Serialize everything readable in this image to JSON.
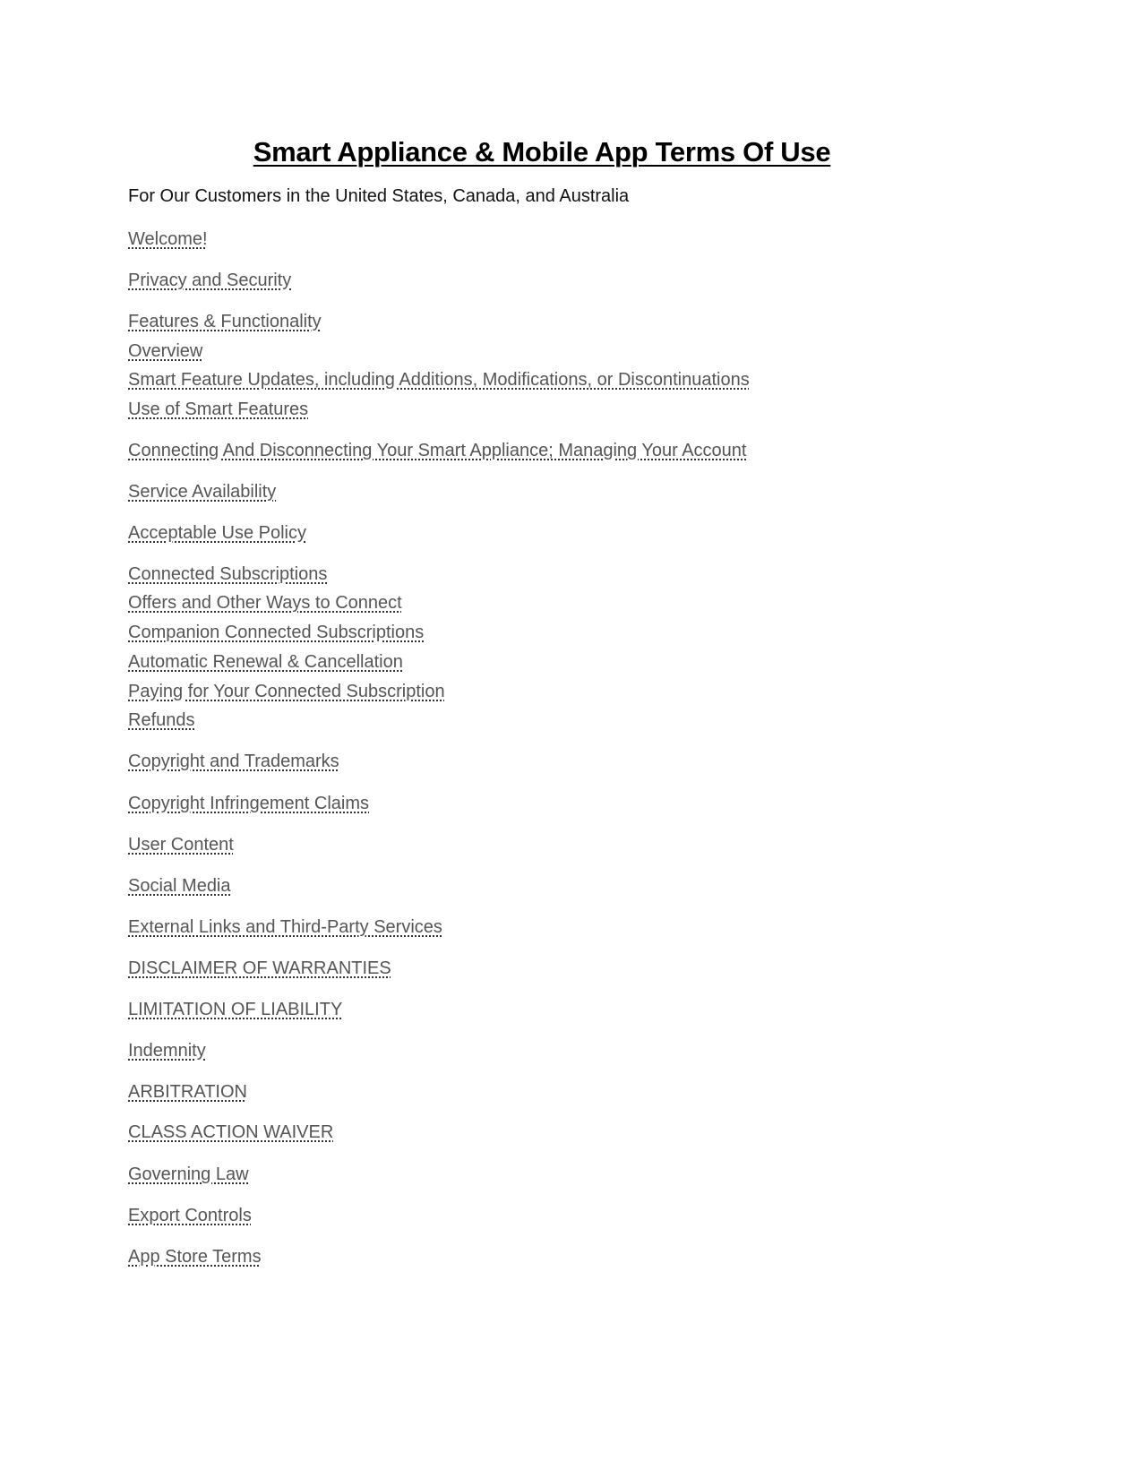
{
  "document": {
    "title": "Smart Appliance & Mobile App Terms Of Use",
    "subtitle": "For Our Customers in the United States, Canada, and Australia",
    "toc": [
      "Welcome!",
      "Privacy and Security",
      "Features & Functionality",
      "Overview",
      "Smart Feature Updates, including Additions, Modifications, or Discontinuations",
      "Use of Smart Features",
      "Connecting And Disconnecting Your Smart Appliance; Managing Your Account",
      "Service Availability",
      "Acceptable Use Policy",
      "Connected Subscriptions",
      "Offers and Other Ways to Connect",
      "Companion Connected Subscriptions",
      "Automatic Renewal & Cancellation",
      "Paying for Your Connected Subscription",
      "Refunds",
      "Copyright and Trademarks",
      "Copyright Infringement Claims",
      "User Content",
      "Social Media",
      "External Links and Third-Party Services",
      "DISCLAIMER OF WARRANTIES",
      "LIMITATION OF LIABILITY",
      "Indemnity",
      "ARBITRATION",
      "CLASS ACTION WAIVER",
      "Governing Law",
      "Export Controls",
      "App Store Terms"
    ]
  }
}
